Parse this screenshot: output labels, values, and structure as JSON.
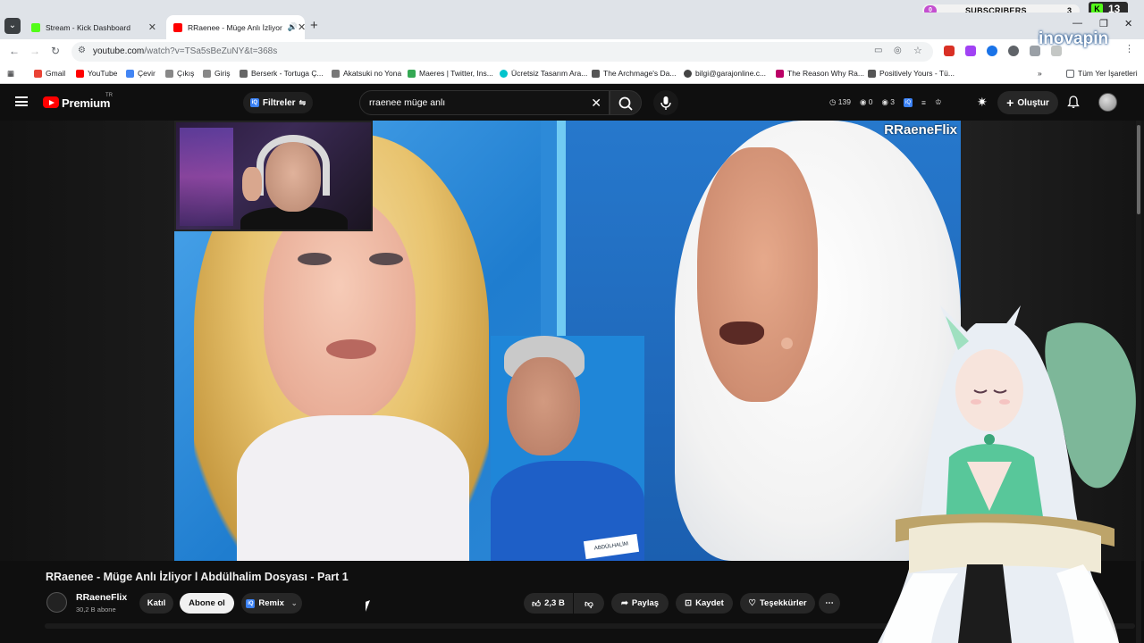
{
  "browser": {
    "tabs": [
      {
        "title": "Stream - Kick Dashboard",
        "active": false,
        "icon": "kick-icon"
      },
      {
        "title": "RRaenee - Müge Anlı İzliyor",
        "active": true,
        "icon": "youtube-icon"
      }
    ],
    "url_host": "youtube.com",
    "url_path": "/watch?v=TSa5sBeZuNY&t=368s",
    "bookmarks": [
      "Gmail",
      "YouTube",
      "Çevir",
      "Çıkış",
      "Giriş",
      "Berserk - Tortuga Ç...",
      "Akatsuki no Yona",
      "Maeres | Twitter, Ins...",
      "Ücretsiz Tasarım Ara...",
      "The Archmage's Da...",
      "bilgi@garajonline.c...",
      "The Reason Why Ra...",
      "Positively Yours - Tü..."
    ],
    "bookmarks_all": "Tüm Yer İşaretleri"
  },
  "overlay": {
    "subscribers_label": "SUBSCRIBERS",
    "subscribers_left": "0",
    "subscribers_count": "3",
    "kick_count": "13",
    "brand": "inovapin"
  },
  "youtube": {
    "logo_text": "Premium",
    "logo_region": "TR",
    "filter_label": "Filtreler",
    "search_query": "rraenee müge anlı",
    "header_stats": {
      "a": "139",
      "b": "0",
      "c": "3"
    },
    "create_label": "Oluştur",
    "video_watermark": "RRaeneFlix",
    "video_title": "RRaenee - Müge Anlı İzliyor l Abdülhalim Dosyası - Part 1",
    "channel_name": "RRaeneFlix",
    "channel_subs": "30,2 B abone",
    "join_label": "Katıl",
    "subscribe_label": "Abone ol",
    "remix_label": "Remix",
    "likes": "2,3 B",
    "share_label": "Paylaş",
    "save_label": "Kaydet",
    "thanks_label": "Teşekkürler",
    "man_tag": "ABDÜLHALİM"
  },
  "colors": {
    "yt_red": "#ff0000",
    "bg": "#0f0f0f",
    "kick_green": "#53fc18"
  }
}
